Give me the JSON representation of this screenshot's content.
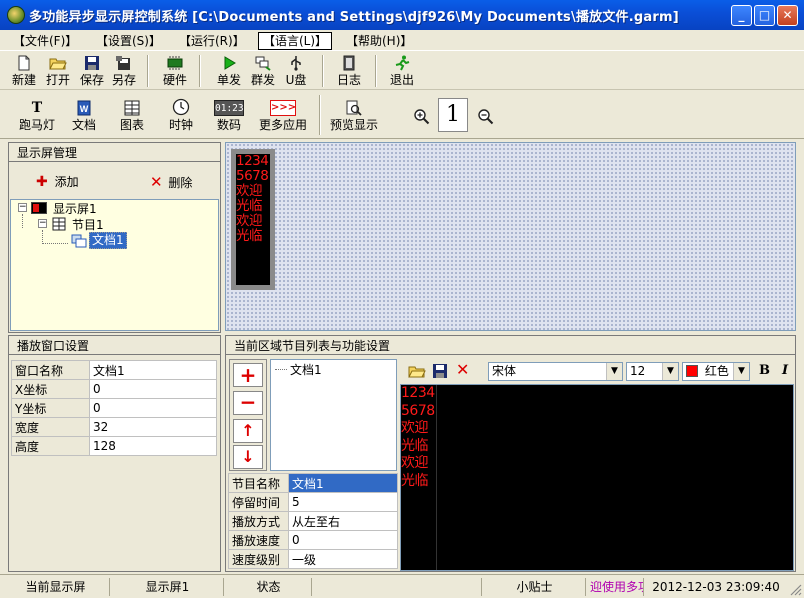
{
  "window": {
    "title": "多功能异步显示屏控制系统 [C:\\Documents and Settings\\djf926\\My Documents\\播放文件.garm]",
    "min_label": "_",
    "max_label": "□",
    "close_label": "✕"
  },
  "menu": [
    "【文件(F)】",
    "【设置(S)】",
    "【运行(R)】",
    "【语言(L)】",
    "【帮助(H)】"
  ],
  "toolbar1": {
    "new": "新建",
    "open": "打开",
    "save": "保存",
    "saveas": "另存",
    "hardware": "硬件",
    "single_send": "单发",
    "group_send": "群发",
    "usb": "U盘",
    "log": "日志",
    "exit": "退出"
  },
  "toolbar2": {
    "marquee": "跑马灯",
    "document": "文档",
    "chart": "图表",
    "clock": "时钟",
    "digital": "数码",
    "digital_icon_text": "01:23",
    "more": "更多应用",
    "more_icon_text": ">>>",
    "preview": "预览显示",
    "zoom_value": "1"
  },
  "screen_panel": {
    "header": "显示屏管理",
    "add": "添加",
    "delete": "删除",
    "tree": {
      "screen": "显示屏1",
      "program": "节目1",
      "doc": "文档1"
    }
  },
  "preview_lines": [
    "1234",
    "5678",
    "欢迎",
    "光临",
    "欢迎",
    "光临"
  ],
  "window_settings": {
    "header": "播放窗口设置",
    "rows": [
      {
        "key": "窗口名称",
        "value": "文档1"
      },
      {
        "key": "X坐标",
        "value": "0"
      },
      {
        "key": "Y坐标",
        "value": "0"
      },
      {
        "key": "宽度",
        "value": "32"
      },
      {
        "key": "高度",
        "value": "128"
      }
    ]
  },
  "program_list": {
    "header": "当前区域节目列表与功能设置",
    "items": [
      "文档1"
    ],
    "props": [
      {
        "key": "节目名称",
        "value": "文档1"
      },
      {
        "key": "停留时间",
        "value": "5"
      },
      {
        "key": "播放方式",
        "value": "从左至右"
      },
      {
        "key": "播放速度",
        "value": "0"
      },
      {
        "key": "速度级别",
        "value": "一级"
      }
    ]
  },
  "editor": {
    "font": "宋体",
    "size": "12",
    "color_name": "红色",
    "color": "#ff0000",
    "bold_label": "B",
    "italic_label": "I",
    "lines": [
      "1234",
      "5678",
      "欢迎",
      "光临",
      "欢迎",
      "光临"
    ]
  },
  "statusbar": {
    "current_screen_label": "当前显示屏",
    "current_screen_value": "显示屏1",
    "status_label": "状态",
    "tip_label": "小贴士",
    "marquee_text": "迎使用多功",
    "datetime": "2012-12-03 23:09:40"
  },
  "colors": {
    "title_bar": "#0a4fd8",
    "led_text": "#ff1a1a",
    "selection": "#316ac5"
  }
}
